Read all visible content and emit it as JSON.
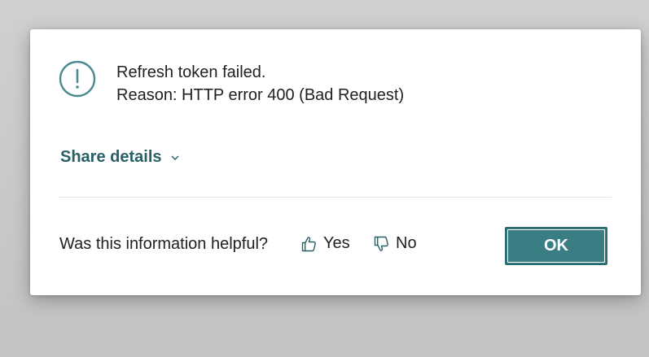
{
  "dialog": {
    "icon": "exclamation-circle-icon",
    "message_lines": [
      "Refresh token failed.",
      "Reason: HTTP error 400 (Bad Request)"
    ],
    "share_details_label": "Share details",
    "share_details_icon": "chevron-down-icon",
    "feedback_question": "Was this information helpful?",
    "yes_label": "Yes",
    "yes_icon": "thumbs-up-icon",
    "no_label": "No",
    "no_icon": "thumbs-down-icon",
    "ok_label": "OK"
  },
  "colors": {
    "accent": "#3a7d83",
    "link": "#2a5f66",
    "icon": "#4a8a90",
    "text": "#212121",
    "overlay": "#c9c9c9"
  }
}
